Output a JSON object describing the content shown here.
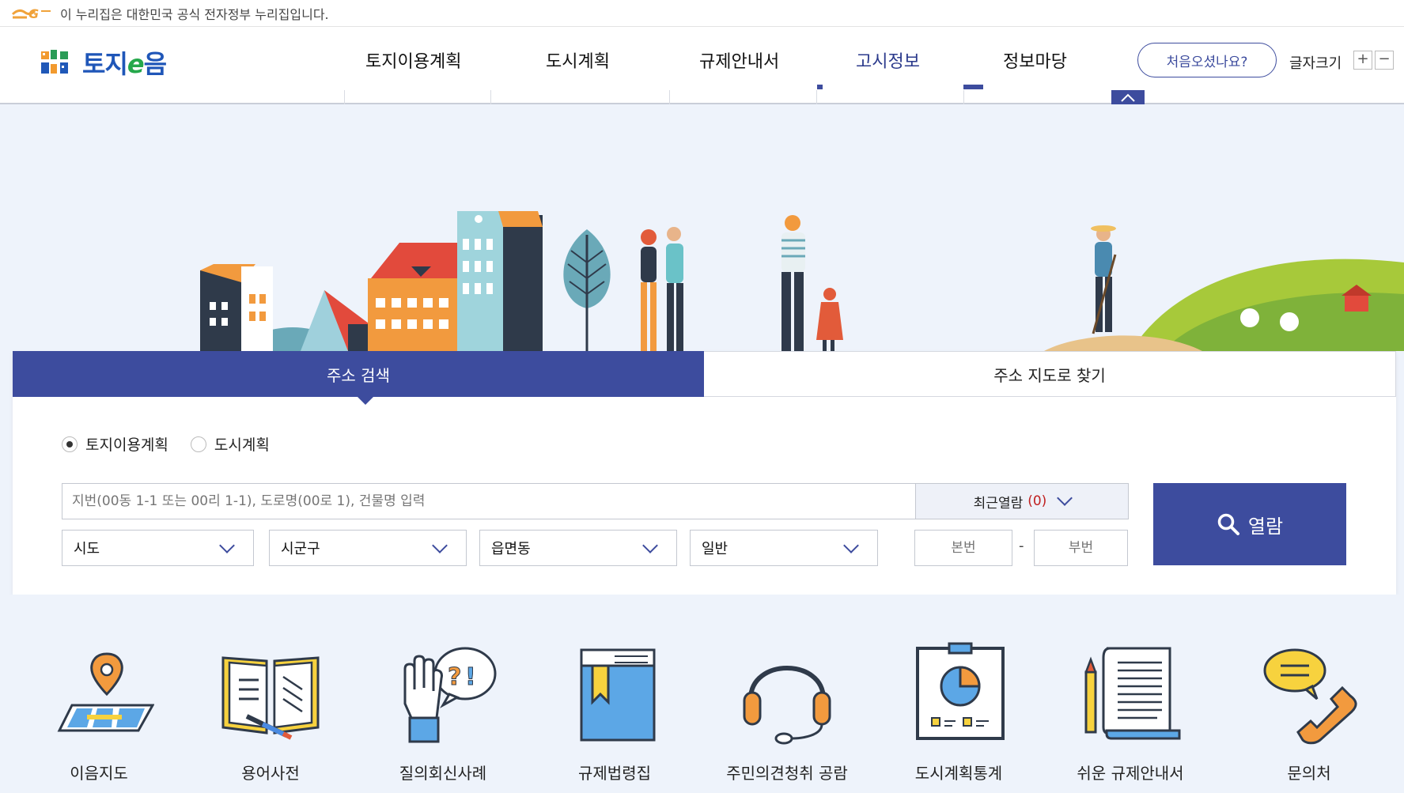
{
  "gov_banner": {
    "text": "이 누리집은 대한민국 공식 전자정부 누리집입니다."
  },
  "brand": {
    "logo_text_a": "토지",
    "logo_text_e": "e",
    "logo_text_b": "음"
  },
  "gnb": [
    {
      "label": "토지이용계획"
    },
    {
      "label": "도시계획"
    },
    {
      "label": "규제안내서"
    },
    {
      "label": "고시정보"
    },
    {
      "label": "정보마당"
    }
  ],
  "header": {
    "first_visit": "처음오셨나요?",
    "font_size_label": "글자크기",
    "plus": "+",
    "minus": "−"
  },
  "colors": {
    "primary": "#3d4c9e",
    "accent_red": "#c02020",
    "background": "#eef3fb"
  },
  "search": {
    "tabs": [
      {
        "label": "주소 검색"
      },
      {
        "label": "주소 지도로 찾기"
      }
    ],
    "radios": [
      {
        "label": "토지이용계획",
        "checked": true
      },
      {
        "label": "도시계획",
        "checked": false
      }
    ],
    "address_placeholder": "지번(00동 1-1 또는 00리 1-1), 도로명(00로 1), 건물명 입력",
    "recent_label": "최근열람",
    "recent_count": "(0)",
    "selects": [
      {
        "value": "시도"
      },
      {
        "value": "시군구"
      },
      {
        "value": "읍면동"
      },
      {
        "value": "일반"
      }
    ],
    "main_no_placeholder": "본번",
    "sub_no_placeholder": "부번",
    "dash": "-",
    "open_label": "열람"
  },
  "quick_links": [
    {
      "label": "이음지도",
      "icon": "map-pin-icon"
    },
    {
      "label": "용어사전",
      "icon": "open-book-icon"
    },
    {
      "label": "질의회신사례",
      "icon": "question-hand-icon"
    },
    {
      "label": "규제법령집",
      "icon": "law-book-icon"
    },
    {
      "label": "주민의견청취 공람",
      "icon": "headset-icon"
    },
    {
      "label": "도시계획통계",
      "icon": "chart-board-icon"
    },
    {
      "label": "쉬운 규제안내서",
      "icon": "document-scroll-icon"
    },
    {
      "label": "문의처",
      "icon": "phone-chat-icon"
    }
  ]
}
